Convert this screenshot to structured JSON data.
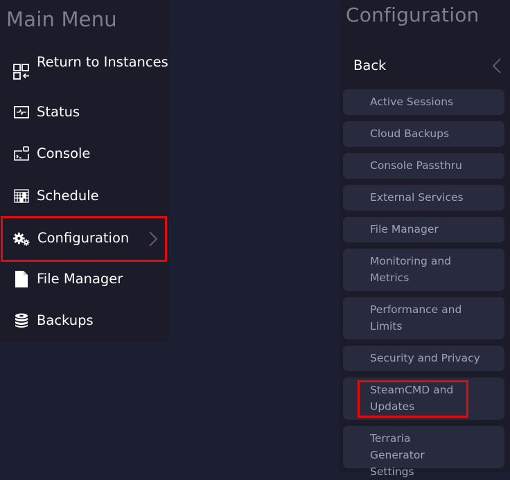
{
  "main_menu": {
    "title": "Main Menu",
    "items": [
      {
        "label": "Return to Instances",
        "icon": "return-to-instances-icon"
      },
      {
        "label": "Status",
        "icon": "status-pulse-icon"
      },
      {
        "label": "Console",
        "icon": "console-icon"
      },
      {
        "label": "Schedule",
        "icon": "schedule-grid-icon"
      },
      {
        "label": "Configuration",
        "icon": "gears-icon",
        "has_submenu": true,
        "highlighted": true
      },
      {
        "label": "File Manager",
        "icon": "file-icon"
      },
      {
        "label": "Backups",
        "icon": "database-icon"
      }
    ]
  },
  "configuration_menu": {
    "title": "Configuration",
    "back_label": "Back",
    "items": [
      {
        "label": "Active Sessions"
      },
      {
        "label": "Cloud Backups"
      },
      {
        "label": "Console Passthru"
      },
      {
        "label": "External Services"
      },
      {
        "label": "File Manager"
      },
      {
        "label": "Monitoring and Metrics"
      },
      {
        "label": "Performance and Limits"
      },
      {
        "label": "Security and Privacy"
      },
      {
        "label": "SteamCMD and Updates",
        "highlighted": true
      },
      {
        "label": "Terraria Generator Settings"
      }
    ]
  },
  "colors": {
    "highlight": "#e8090c",
    "panel_bg": "#1c1b29",
    "page_bg": "#1b1f31",
    "sub_item_bg": "#282a3d",
    "sub_item_text": "#9da4b7"
  }
}
